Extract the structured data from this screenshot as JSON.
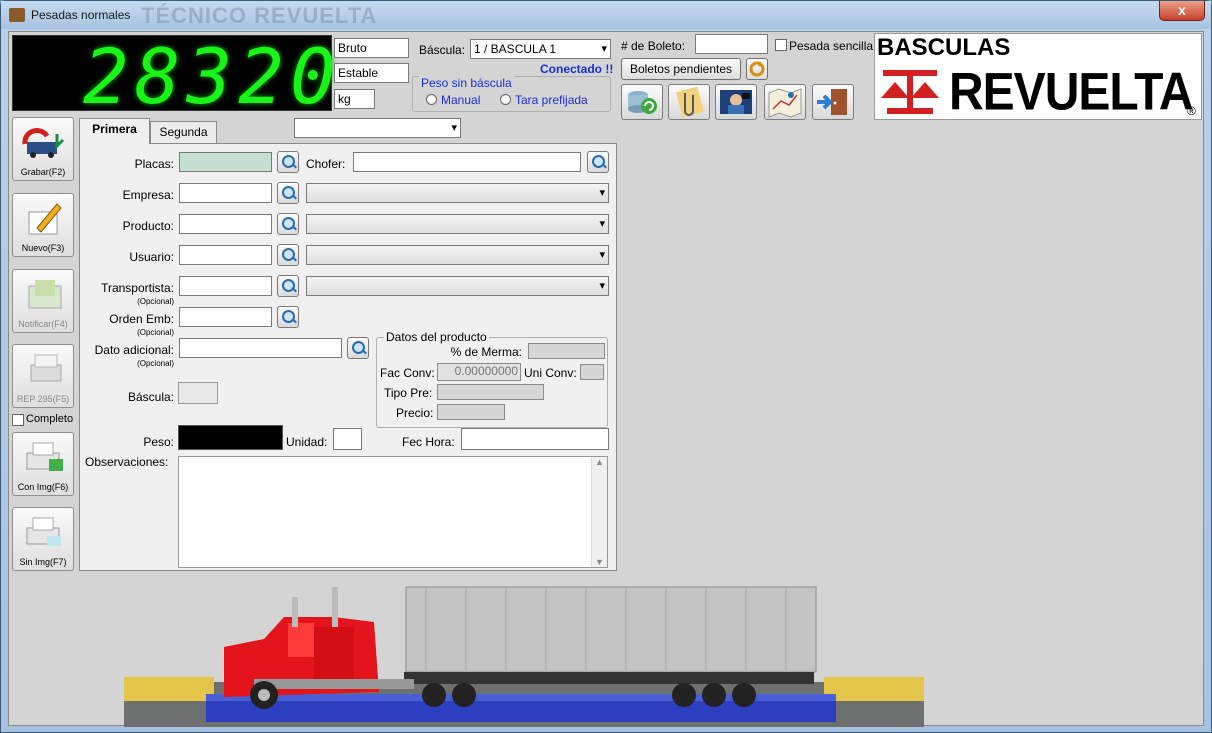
{
  "window": {
    "title": "Pesadas normales",
    "watermark": "TÉCNICO REVUELTA",
    "close": "x"
  },
  "display": {
    "value": "28320",
    "mode": "Bruto",
    "state": "Estable",
    "unit": "kg"
  },
  "bascula": {
    "label": "Báscula:",
    "value": "1 / BASCULA 1",
    "status": "Conectado !!"
  },
  "peso_sin_bascula": {
    "legend": "Peso sin báscula",
    "manual": "Manual",
    "tara": "Tara prefijada"
  },
  "boleto": {
    "label": "# de Boleto:",
    "value": "",
    "pesada_sencilla": "Pesada sencilla",
    "pendientes": "Boletos pendientes"
  },
  "logo": {
    "line1": "BASCULAS",
    "line2": "REVUELTA",
    "mark": "®"
  },
  "sidebar": {
    "grabar": "Grabar(F2)",
    "nuevo": "Nuevo(F3)",
    "notificar": "Notificar(F4)",
    "rep": "REP 295(F5)",
    "completo": "Completo",
    "con_img": "Con Img(F6)",
    "sin_img": "Sin Img(F7)"
  },
  "tabs": {
    "primera": "Primera",
    "segunda": "Segunda",
    "combo": ""
  },
  "form": {
    "placas": "Placas:",
    "chofer": "Chofer:",
    "empresa": "Empresa:",
    "producto": "Producto:",
    "usuario": "Usuario:",
    "transportista": "Transportista:",
    "orden_emb": "Orden Emb:",
    "dato_adicional": "Dato adicional:",
    "opcional": "(Opcional)",
    "bascula": "Báscula:",
    "peso": "Peso:",
    "unidad": "Unidad:",
    "fec_hora": "Fec Hora:",
    "observaciones": "Observaciones:"
  },
  "datos_producto": {
    "legend": "Datos del producto",
    "merma": "% de Merma:",
    "fac_conv": "Fac Conv:",
    "fac_conv_value": "0.00000000",
    "uni_conv": "Uni Conv:",
    "tipo_pre": "Tipo Pre:",
    "precio": "Precio:"
  },
  "colors": {
    "display_bg": "#000000",
    "display_digits": "#19f419",
    "status": "#1a2fd4",
    "logo_red": "#d21f1f",
    "truck": "#e3141b"
  },
  "icons": [
    "scale-refresh-icon",
    "paperclip-icon",
    "camera-operator-icon",
    "map-icon",
    "exit-door-icon",
    "boleto-refresh-icon",
    "search-icon"
  ]
}
